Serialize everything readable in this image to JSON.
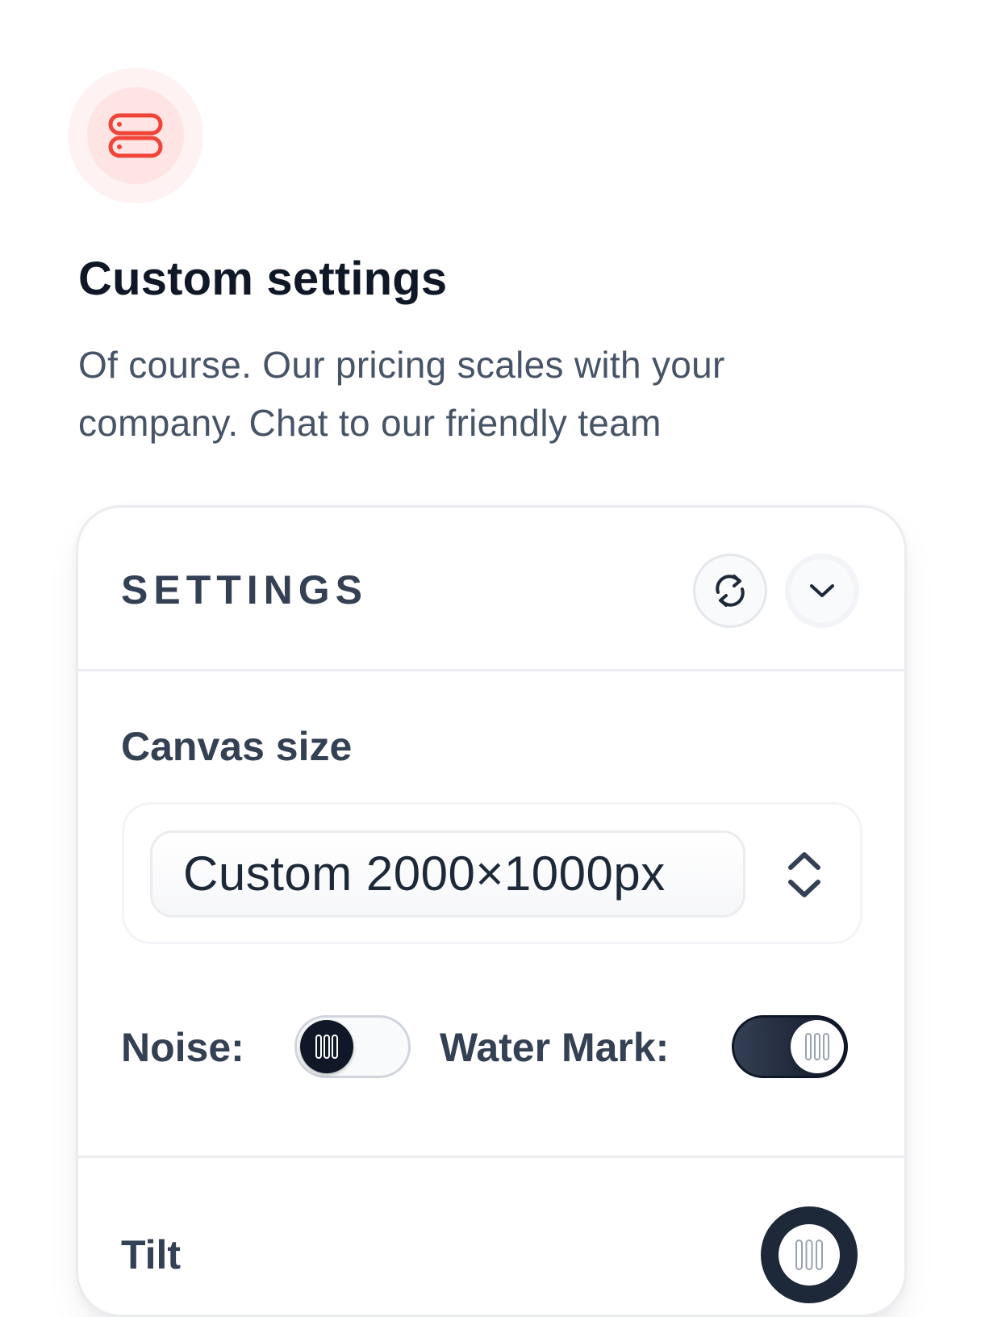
{
  "header": {
    "icon": "server-stack-icon",
    "title": "Custom settings",
    "description": "Of course. Our pricing scales with your company. Chat to our friendly team"
  },
  "settings_card": {
    "title": "SETTINGS",
    "refresh_icon": "refresh-icon",
    "collapse_icon": "chevron-down-icon",
    "canvas_size": {
      "label": "Canvas size",
      "selected_value": "Custom 2000×1000px",
      "arrows_icon": "chevron-up-down-icon"
    },
    "noise": {
      "label": "Noise:",
      "enabled": false
    },
    "watermark": {
      "label": "Water Mark:",
      "enabled": true
    },
    "tilt": {
      "label": "Tilt"
    }
  },
  "colors": {
    "accent_red": "#f04438",
    "icon_bg_outer": "#fef3f2",
    "icon_bg_inner": "#fee4e2",
    "dark": "#101828",
    "label_gray": "#344054",
    "text_gray": "#475467"
  }
}
